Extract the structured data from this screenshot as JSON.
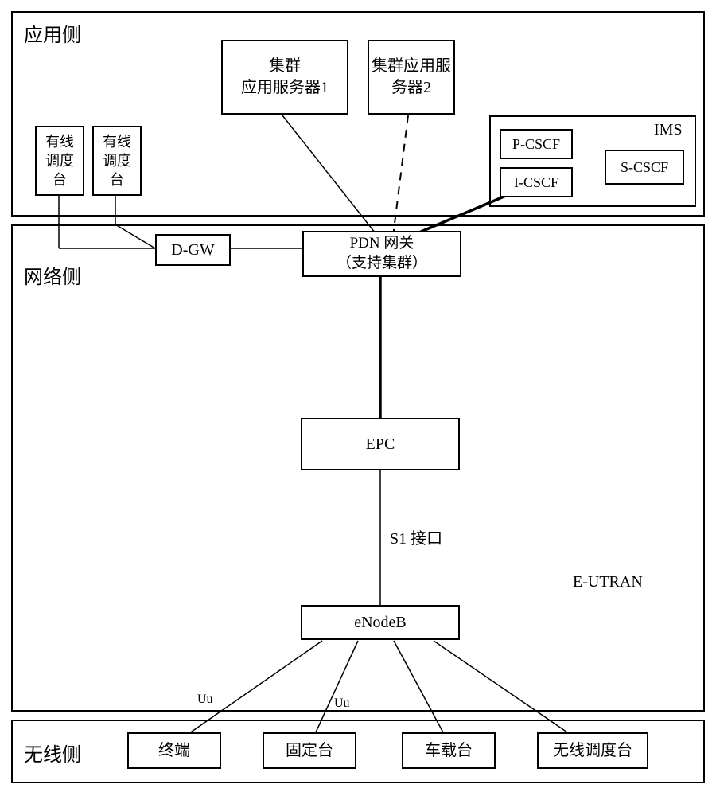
{
  "regions": {
    "app": "应用侧",
    "net": "网络侧",
    "wireless": "无线侧"
  },
  "nodes": {
    "dispatch1": "有线\n调度\n台",
    "dispatch2": "有线\n调度\n台",
    "cluster1": "集群\n应用服务器1",
    "cluster2": "集群应用服\n务器2",
    "ims": "IMS",
    "pcscf": "P-CSCF",
    "icscf": "I-CSCF",
    "scscf": "S-CSCF",
    "dgw": "D-GW",
    "pdn": "PDN 网关\n（支持集群）",
    "epc": "EPC",
    "enodeb": "eNodeB",
    "term": "终端",
    "fixed": "固定台",
    "vehicle": "车载台",
    "wdispatch": "无线调度台"
  },
  "labels": {
    "s1": "S1 接口",
    "uu1": "Uu",
    "uu2": "Uu",
    "eutran": "E-UTRAN"
  }
}
